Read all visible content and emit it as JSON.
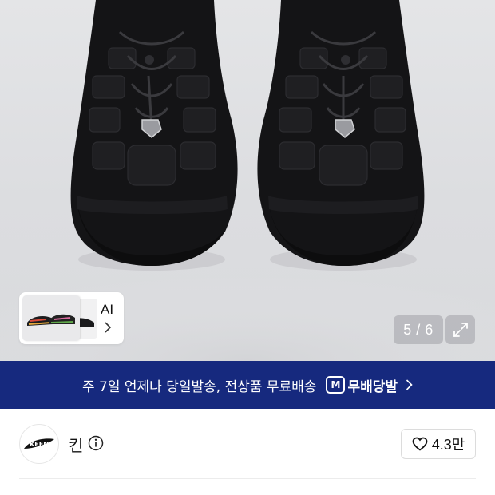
{
  "gallery": {
    "thumbnail_label": "AI",
    "counter": "5 / 6",
    "image_description_icon": "sandal-pair-photo",
    "expand_icon": "expand-arrows-icon"
  },
  "banner": {
    "text": "주 7일 언제나 당일발송, 전상품 무료배송",
    "logo_letter": "M",
    "brand": "무배당발",
    "background": "#16297e"
  },
  "brand_row": {
    "name": "킨",
    "logo_text": "KEEN",
    "like_count": "4.3만"
  }
}
